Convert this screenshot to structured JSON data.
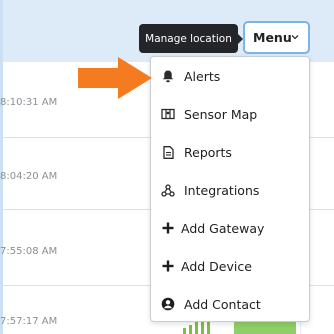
{
  "header": {
    "tooltip": "Manage location",
    "menu_label": "Menu"
  },
  "rows": [
    {
      "time": "8:10:31 AM"
    },
    {
      "time": "8:04:20 AM"
    },
    {
      "time": "7:55:08 AM"
    },
    {
      "time": "7:57:17 AM"
    }
  ],
  "menu": {
    "items": [
      {
        "label": "Alerts",
        "icon": "bell-icon"
      },
      {
        "label": "Sensor Map",
        "icon": "map-icon"
      },
      {
        "label": "Reports",
        "icon": "document-icon"
      },
      {
        "label": "Integrations",
        "icon": "webhook-icon"
      },
      {
        "label": "Add Gateway",
        "icon": "plus-icon"
      },
      {
        "label": "Add Device",
        "icon": "plus-icon"
      },
      {
        "label": "Add Contact",
        "icon": "user-circle-icon"
      }
    ]
  },
  "status": {
    "badge_text": "",
    "badge_color": "#8fcf67",
    "signal_color": "#7ac143",
    "accent": "#7cb4e8",
    "arrow_color": "#f47b20"
  }
}
